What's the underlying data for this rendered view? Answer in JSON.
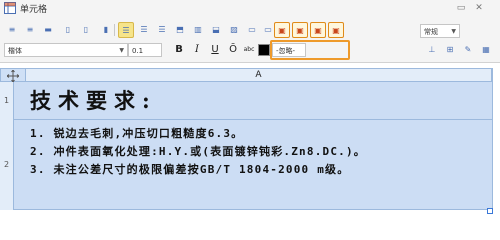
{
  "window": {
    "title": "单元格",
    "min_icon": "minimize-icon",
    "close_icon": "close-icon"
  },
  "toolbar": {
    "style_select": {
      "value": "常规"
    },
    "orange_group_icons": [
      "cell-border-top-icon",
      "cell-border-left-icon",
      "cell-border-right-icon",
      "cell-border-bottom-icon"
    ]
  },
  "format": {
    "font_select": {
      "value": "楷体"
    },
    "size_input": {
      "value": "0.1"
    },
    "bold": "B",
    "italic": "I",
    "underline": "U",
    "overline": "Ō",
    "abc": "abc",
    "color_swatch": "#000000",
    "color_label": "-忽略-"
  },
  "grid": {
    "column_header": "A",
    "rows": [
      {
        "number": "1",
        "text": "技术要求:"
      },
      {
        "number": "2",
        "lines": [
          "1. 锐边去毛刺,冲压切口粗糙度6.3。",
          "2. 冲件表面氧化处理:H.Y.或(表面镀锌钝彩.Zn8.DC.)。",
          "3. 未注公差尺寸的极限偏差按GB/T 1804-2000 m级。"
        ]
      }
    ]
  },
  "colors": {
    "accent": "#ee9a2b",
    "cell_fill": "#ccddf4",
    "header_fill": "#e3edf9"
  }
}
